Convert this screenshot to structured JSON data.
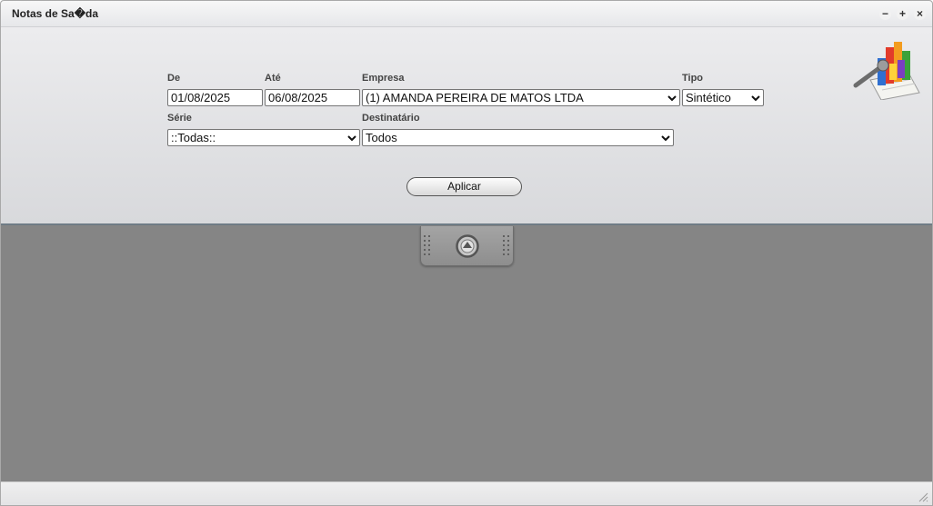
{
  "window": {
    "title": "Notas de Sa�da",
    "controls": {
      "minimize": "−",
      "maximize": "+",
      "close": "×"
    }
  },
  "form": {
    "de": {
      "label": "De",
      "value": "01/08/2025"
    },
    "ate": {
      "label": "Até",
      "value": "06/08/2025"
    },
    "empresa": {
      "label": "Empresa",
      "value": "(1) AMANDA PEREIRA DE MATOS LTDA"
    },
    "tipo": {
      "label": "Tipo",
      "value": "Sintético"
    },
    "serie": {
      "label": "Série",
      "value": "::Todas::"
    },
    "destinatario": {
      "label": "Destinatário",
      "value": "Todos"
    },
    "apply_label": "Aplicar"
  },
  "icons": {
    "report": "bar-chart-report-icon",
    "collapse": "chevron-up-circle-icon",
    "resize": "resize-grip-icon"
  },
  "colors": {
    "content_background": "#858585",
    "panel_bottom_border": "#6f7c86"
  }
}
